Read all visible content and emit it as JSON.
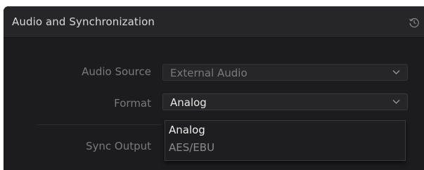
{
  "panel": {
    "title": "Audio and Synchronization",
    "reset_icon": "reset-icon"
  },
  "fields": {
    "audio_source": {
      "label": "Audio Source",
      "value": "External Audio",
      "disabled": true
    },
    "format": {
      "label": "Format",
      "value": "Analog",
      "disabled": false
    },
    "sync_output": {
      "label": "Sync Output"
    }
  },
  "dropdown": {
    "options": [
      {
        "label": "Analog",
        "selected": true
      },
      {
        "label": "AES/EBU",
        "selected": false
      }
    ]
  },
  "colors": {
    "panel_bg": "#1c1c1e",
    "header_bg": "#262628",
    "label_text": "#7a7a7d",
    "value_text": "#e6e6e6",
    "disabled_text": "#7a7a7d"
  }
}
